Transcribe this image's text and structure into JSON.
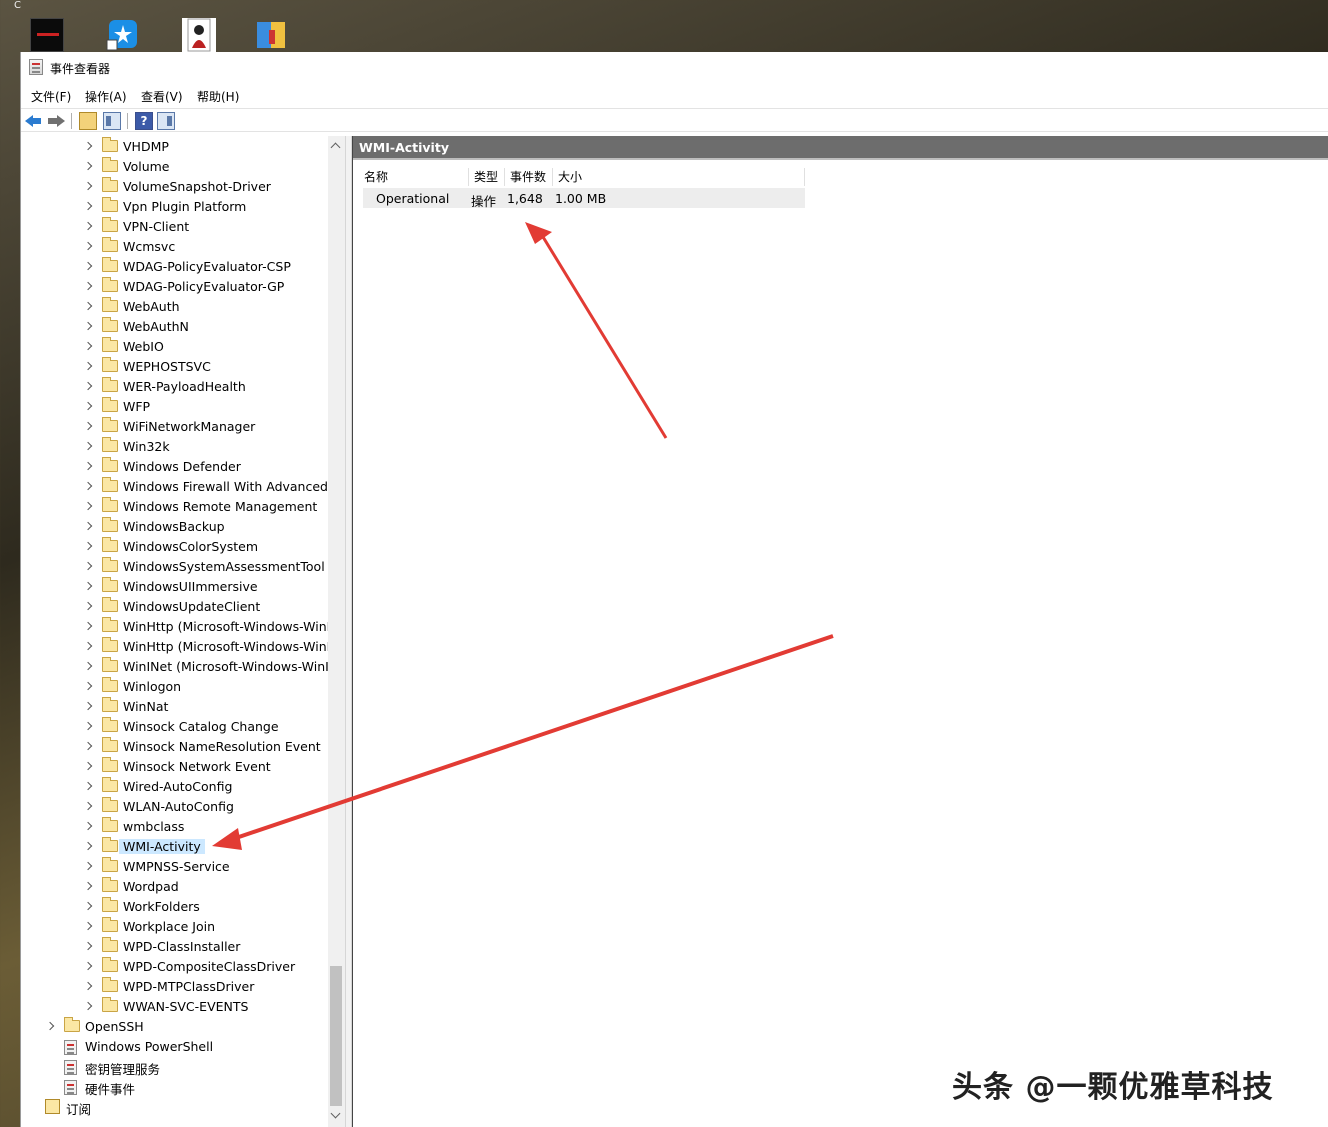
{
  "desktop": {
    "caption": "C"
  },
  "window": {
    "title": "事件查看器"
  },
  "menu": [
    "文件(F)",
    "操作(A)",
    "查看(V)",
    "帮助(H)"
  ],
  "toolbar": {
    "icons": [
      "back-arrow-icon",
      "forward-arrow-icon",
      "folder-up-icon",
      "show-hide-console-tree-icon",
      "help-icon",
      "show-hide-action-pane-icon"
    ]
  },
  "tree": {
    "items": [
      "VHDMP",
      "Volume",
      "VolumeSnapshot-Driver",
      "Vpn Plugin Platform",
      "VPN-Client",
      "Wcmsvc",
      "WDAG-PolicyEvaluator-CSP",
      "WDAG-PolicyEvaluator-GP",
      "WebAuth",
      "WebAuthN",
      "WebIO",
      "WEPHOSTSVC",
      "WER-PayloadHealth",
      "WFP",
      "WiFiNetworkManager",
      "Win32k",
      "Windows Defender",
      "Windows Firewall With Advanced Se",
      "Windows Remote Management",
      "WindowsBackup",
      "WindowsColorSystem",
      "WindowsSystemAssessmentTool",
      "WindowsUIImmersive",
      "WindowsUpdateClient",
      "WinHttp (Microsoft-Windows-WinH",
      "WinHttp (Microsoft-Windows-WinIN",
      "WinINet (Microsoft-Windows-WinIN",
      "Winlogon",
      "WinNat",
      "Winsock Catalog Change",
      "Winsock NameResolution Event",
      "Winsock Network Event",
      "Wired-AutoConfig",
      "WLAN-AutoConfig",
      "wmbclass",
      "WMI-Activity",
      "WMPNSS-Service",
      "Wordpad",
      "WorkFolders",
      "Workplace Join",
      "WPD-ClassInstaller",
      "WPD-CompositeClassDriver",
      "WPD-MTPClassDriver",
      "WWAN-SVC-EVENTS"
    ],
    "selected_index": 35,
    "openssh": "OpenSSH",
    "powershell": "Windows PowerShell",
    "kms": "密钥管理服务",
    "hardware": "硬件事件",
    "subscriptions": "订阅"
  },
  "right": {
    "header": "WMI-Activity",
    "columns": [
      "名称",
      "类型",
      "事件数",
      "大小"
    ],
    "row": {
      "name": "Operational",
      "type": "操作",
      "count": "1,648",
      "size": "1.00 MB"
    }
  },
  "watermark": "头条 @一颗优雅草科技",
  "colors": {
    "arrow": "#e23b34",
    "header_bg": "#6d6d6d",
    "selected_bg": "#cce8ff"
  }
}
